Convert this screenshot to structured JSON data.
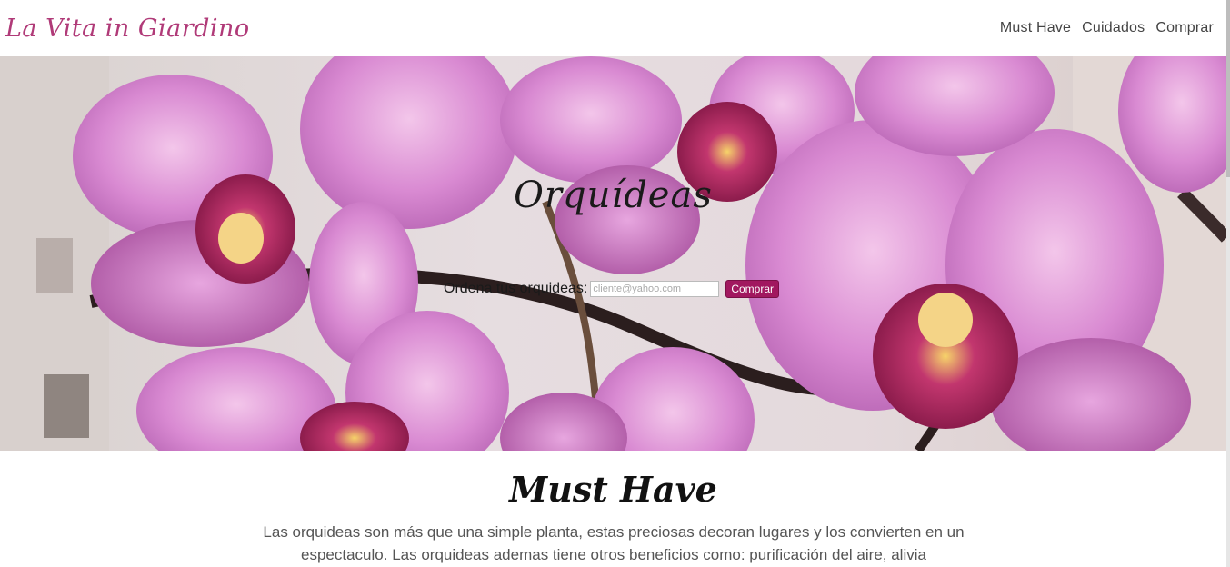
{
  "brand": "La Vita in Giardino",
  "nav": {
    "items": [
      "Must Have",
      "Cuidados",
      "Comprar"
    ]
  },
  "hero": {
    "title": "Orquídeas",
    "order_label": "Ordena tus orquideas:",
    "email_placeholder": "cliente@yahoo.com",
    "buy_button": "Comprar"
  },
  "section": {
    "title": "Must Have",
    "text": "Las orquideas son más que una simple planta, estas preciosas decoran lugares y los convierten en un espectaculo. Las orquideas ademas tiene otros beneficios como: purificación del aire, alivia"
  },
  "colors": {
    "brand": "#b03a78",
    "button": "#a1185f"
  }
}
